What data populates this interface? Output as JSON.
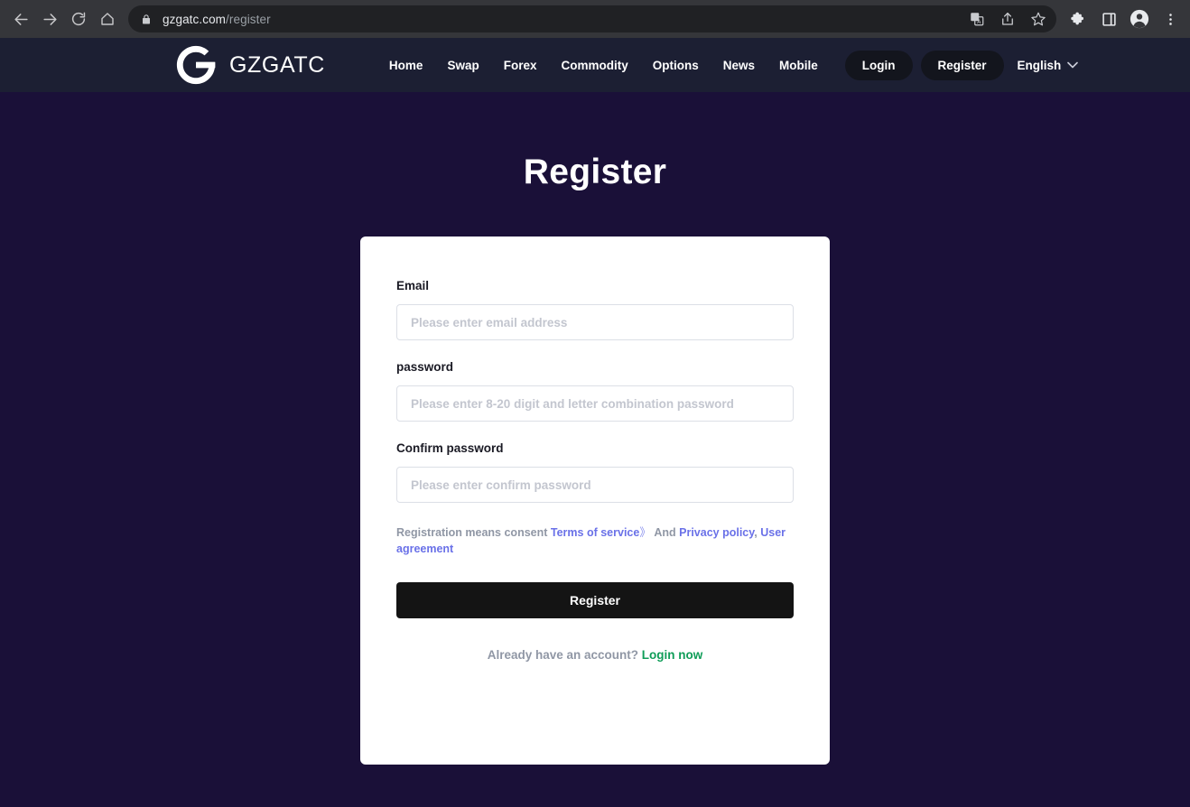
{
  "browser": {
    "back_icon": "back-arrow-icon",
    "forward_icon": "forward-arrow-icon",
    "reload_icon": "reload-icon",
    "home_icon": "home-icon",
    "lock_icon": "lock-icon",
    "url_domain": "gzgatc.com",
    "url_path": "/register",
    "translate_icon": "translate-icon",
    "share_icon": "share-icon",
    "bookmark_icon": "star-icon",
    "extensions_icon": "puzzle-piece-icon",
    "sidepanel_icon": "side-panel-icon",
    "profile_icon": "profile-avatar-icon",
    "menu_icon": "three-dot-menu-icon"
  },
  "header": {
    "logo_icon": "gzgatc-g-logo-icon",
    "brand_name": "GZGATC",
    "nav": [
      {
        "label": "Home"
      },
      {
        "label": "Swap"
      },
      {
        "label": "Forex"
      },
      {
        "label": "Commodity"
      },
      {
        "label": "Options"
      },
      {
        "label": "News"
      },
      {
        "label": "Mobile"
      }
    ],
    "login_label": "Login",
    "register_label": "Register",
    "language_label": "English",
    "language_chevron_icon": "chevron-down-icon"
  },
  "page": {
    "title": "Register"
  },
  "form": {
    "email": {
      "label": "Email",
      "placeholder": "Please enter email address",
      "value": ""
    },
    "password": {
      "label": "password",
      "placeholder": "Please enter 8-20 digit and letter combination password",
      "value": ""
    },
    "confirm_password": {
      "label": "Confirm password",
      "placeholder": "Please enter confirm password",
      "value": ""
    },
    "consent": {
      "prefix": "Registration means consent",
      "terms_link": "Terms of service",
      "arrow": "》",
      "and": "And",
      "privacy_link": "Privacy policy",
      "comma": ",",
      "agreement_link": "User agreement"
    },
    "submit_label": "Register",
    "login_prompt": "Already have an account?",
    "login_link": "Login now"
  },
  "colors": {
    "page_background": "#1a1038",
    "header_background": "#1c1f33",
    "card_background": "#ffffff",
    "accent_link": "#6a71e8",
    "login_link_green": "#0f9d58",
    "submit_button": "#141414",
    "input_border": "#dcdfe6"
  }
}
